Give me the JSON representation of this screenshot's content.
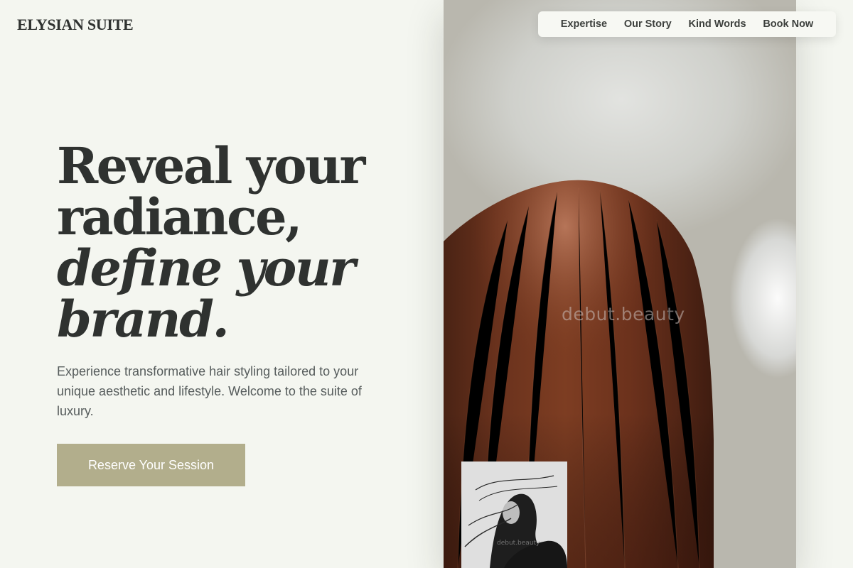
{
  "brand": {
    "name": "ELYSIAN SUITE"
  },
  "nav": {
    "items": [
      {
        "label": "Expertise"
      },
      {
        "label": "Our Story"
      },
      {
        "label": "Kind Words"
      },
      {
        "label": "Book Now"
      }
    ]
  },
  "hero": {
    "headline": {
      "line1": "Reveal your",
      "line2": "radiance,",
      "line3_italic": "define your",
      "line4_italic": "brand."
    },
    "subtext": "Experience transformative hair styling tailored to your unique aesthetic and lifestyle. Welcome to the suite of luxury.",
    "cta_label": "Reserve Your Session",
    "image": {
      "watermark": "debut.beauty"
    },
    "thumbnail": {
      "watermark": "debut.beauty"
    }
  },
  "colors": {
    "background": "#f4f6f0",
    "text_dark": "#2f3230",
    "text_muted": "#565c5c",
    "accent": "#b2ae8c"
  }
}
